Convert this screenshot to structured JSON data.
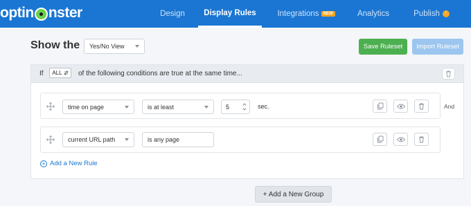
{
  "brand": {
    "logo_text_1": "optin",
    "logo_text_2": "nster"
  },
  "nav": {
    "design": "Design",
    "display_rules": "Display Rules",
    "integrations": "Integrations",
    "integrations_badge": "NEW",
    "analytics": "Analytics",
    "publish": "Publish",
    "publish_badge": "!"
  },
  "toolbar": {
    "show_the": "Show the",
    "view_select": "Yes/No View",
    "save_ruleset": "Save Ruleset",
    "import_ruleset": "Import Ruleset"
  },
  "group": {
    "if_label": "If",
    "all_select": "ALL",
    "condition_text": "of the following conditions are true at the same time...",
    "rules": [
      {
        "field": "time on page",
        "operator": "is at least",
        "value": "5",
        "unit": "sec.",
        "connector": "And"
      },
      {
        "field": "current URL path",
        "operator": "is any page"
      }
    ],
    "add_rule": "Add a New Rule"
  },
  "add_group": "+ Add a New Group",
  "colors": {
    "nav_bg": "#1a76d2",
    "save_green": "#4caf50",
    "import_blue": "#9cc6ef",
    "accent": "#f5a623"
  }
}
